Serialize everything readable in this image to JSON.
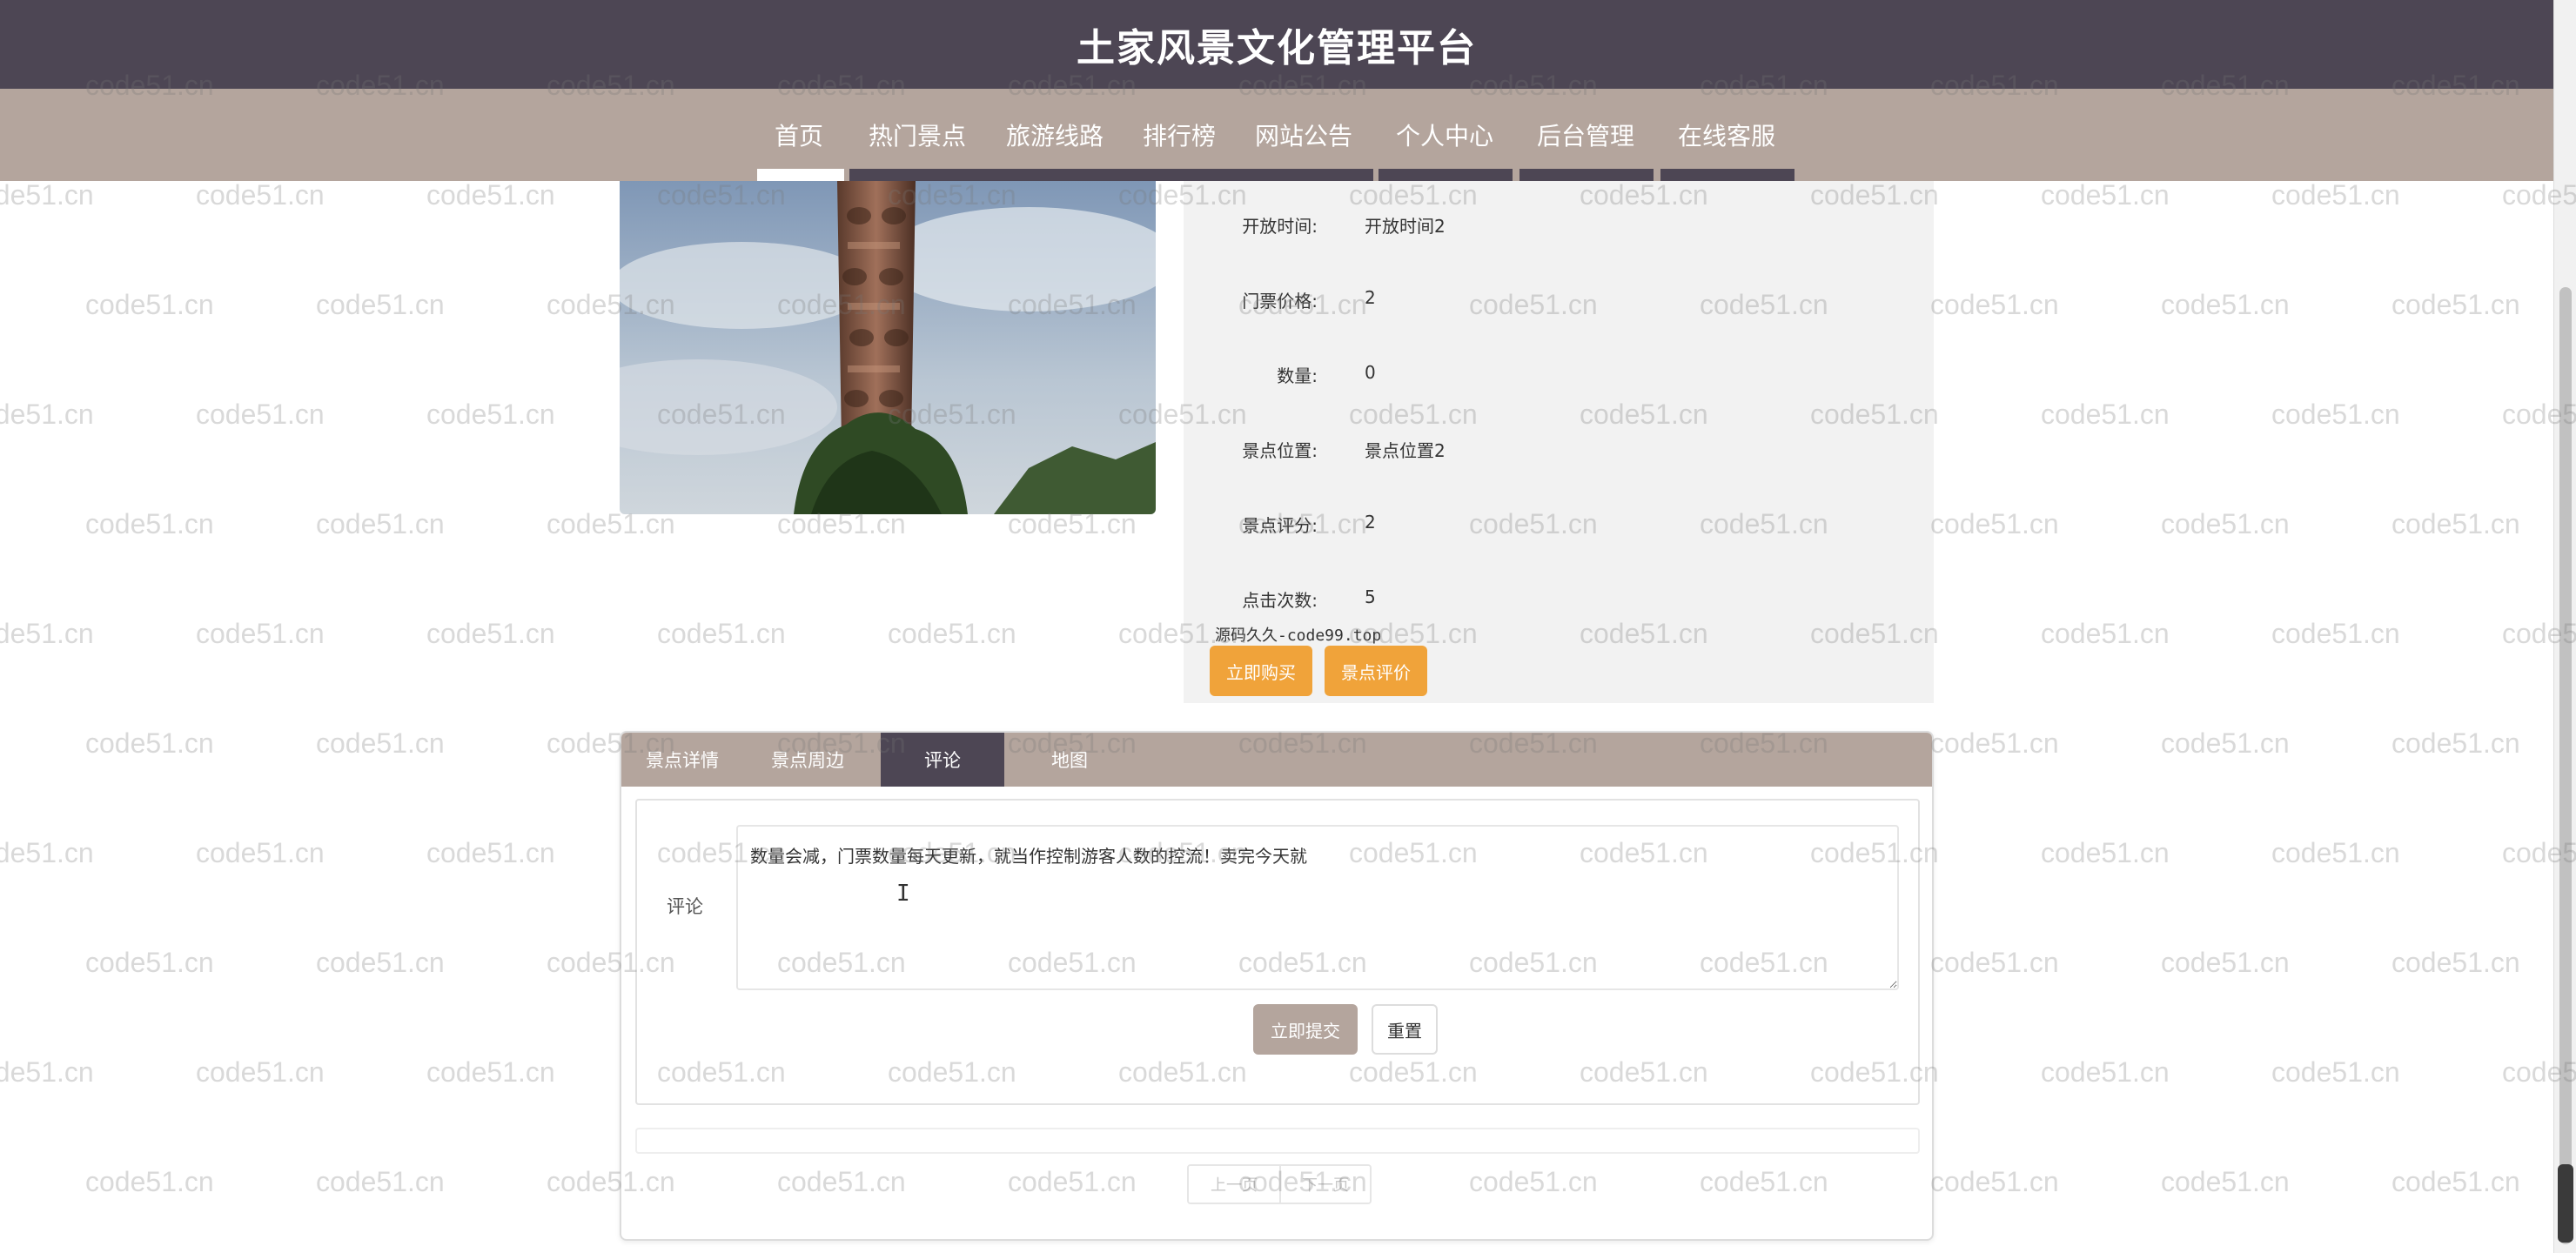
{
  "header": {
    "title": "土家风景文化管理平台"
  },
  "nav": {
    "items": [
      "首页",
      "热门景点",
      "旅游线路",
      "排行榜",
      "网站公告",
      "个人中心",
      "后台管理",
      "在线客服"
    ],
    "active": "首页"
  },
  "info": {
    "rows": [
      {
        "label": "开放时间:",
        "value": "开放时间2"
      },
      {
        "label": "门票价格:",
        "value": "2"
      },
      {
        "label": "数量:",
        "value": "0"
      },
      {
        "label": "景点位置:",
        "value": "景点位置2"
      },
      {
        "label": "景点评分:",
        "value": "2"
      },
      {
        "label": "点击次数:",
        "value": "5"
      }
    ],
    "source_note": "源码久久-code99.top",
    "buy_label": "立即购买",
    "review_label": "景点评价"
  },
  "tabs": {
    "items": [
      "景点详情",
      "景点周边",
      "评论",
      "地图"
    ],
    "active": "评论"
  },
  "comment": {
    "label": "评论",
    "text": "数量会减，门票数量每天更新，就当作控制游客人数的控流！卖完今天就",
    "submit_label": "立即提交",
    "reset_label": "重置"
  },
  "pager": {
    "prev_label": "上一页",
    "next_label": "下一页"
  },
  "watermark": {
    "text": "code51.cn"
  },
  "colors": {
    "header_bg": "#4d4654",
    "nav_bg": "#b4a59d",
    "accent_orange": "#f0a33a",
    "panel_bg": "#f2f2f2"
  },
  "icons": [
    "text-cursor-icon",
    "resize-grip-icon"
  ]
}
